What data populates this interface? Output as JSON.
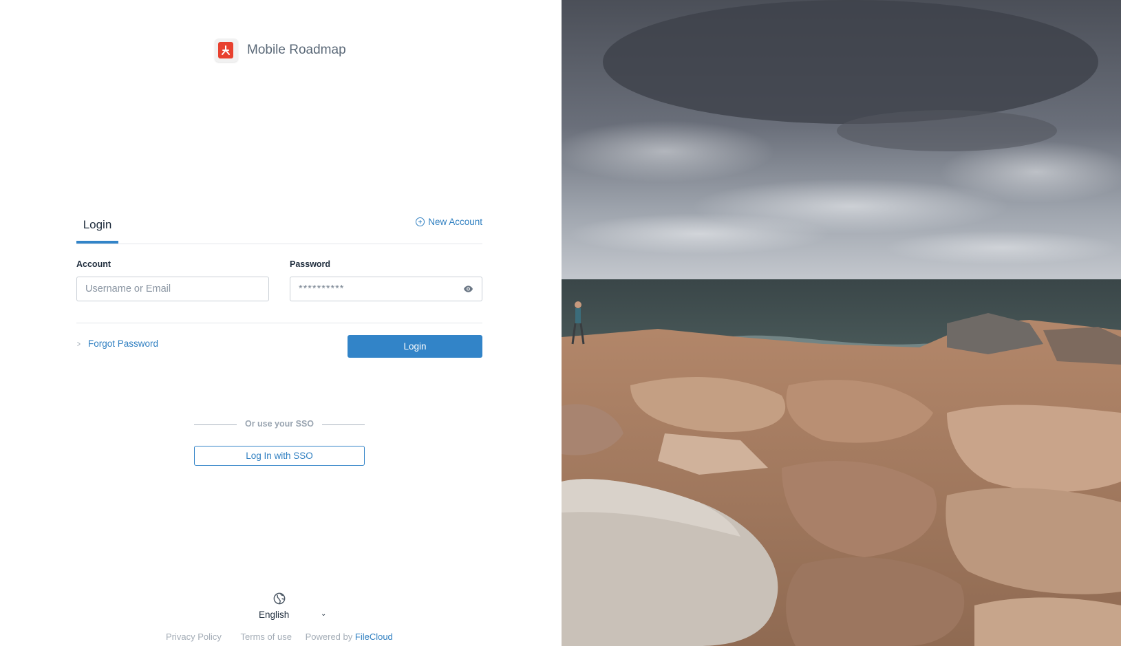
{
  "app": {
    "name": "Mobile Roadmap",
    "logo_icon": "pdf-document-icon",
    "accent": "#3284c8"
  },
  "tabs": {
    "login_label": "Login",
    "new_account_label": "New Account"
  },
  "form": {
    "account_label": "Account",
    "account_placeholder": "Username or Email",
    "password_label": "Password",
    "password_placeholder": "**********",
    "forgot_label": "Forgot Password",
    "login_button": "Login"
  },
  "sso": {
    "divider_text": "Or use your SSO",
    "button_label": "Log In with SSO"
  },
  "footer": {
    "language": "English",
    "privacy_label": "Privacy Policy",
    "terms_label": "Terms of use",
    "powered_by_label": "Powered by",
    "brand": "FileCloud"
  }
}
